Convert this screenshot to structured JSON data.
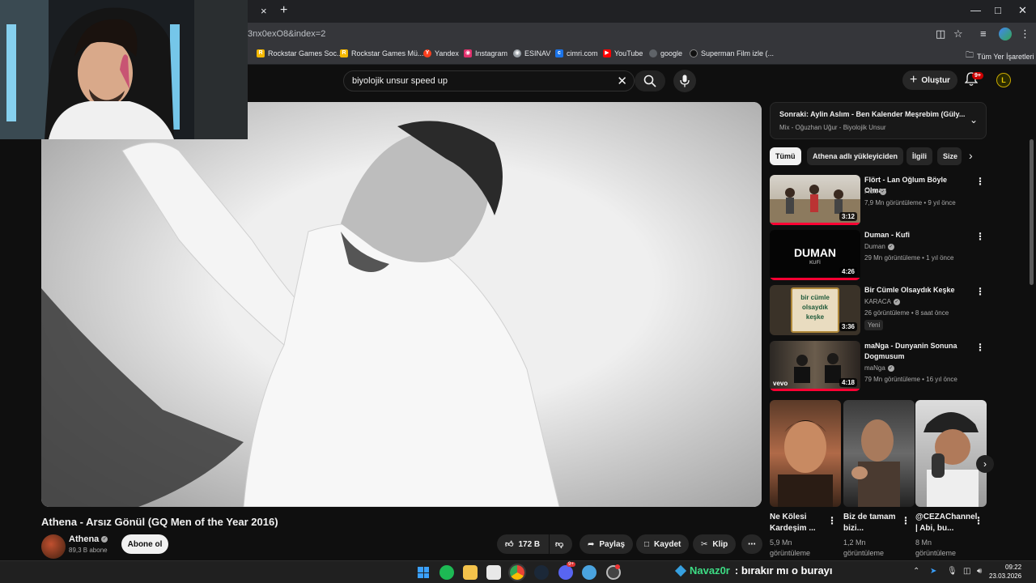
{
  "browser": {
    "url": "3nx0exO8&index=2",
    "tab_close": "×",
    "tab_new": "+",
    "bookmarks": [
      {
        "label": "Rockstar Games Soc...",
        "icon": "rockstar-icon",
        "color": "#f5b800"
      },
      {
        "label": "Rockstar Games Mü...",
        "icon": "rockstar-icon",
        "color": "#f5b800"
      },
      {
        "label": "Yandex",
        "icon": "yandex-icon",
        "color": "#fc3f1d"
      },
      {
        "label": "Instagram",
        "icon": "instagram-icon",
        "color": "#e1306c"
      },
      {
        "label": "ESINAV",
        "icon": "globe-icon",
        "color": "#9aa0a6"
      },
      {
        "label": "cimri.com",
        "icon": "cimri-icon",
        "color": "#1a73e8"
      },
      {
        "label": "YouTube",
        "icon": "youtube-icon",
        "color": "#ff0000"
      },
      {
        "label": "google",
        "icon": "globe-icon",
        "color": "#5f6368"
      },
      {
        "label": "Superman Film izle (...",
        "icon": "superman-icon",
        "color": "#202124"
      }
    ],
    "all_bookmarks": "Tüm Yer İşaretleri"
  },
  "youtube": {
    "search_value": "biyolojik unsur speed up",
    "create_label": "Oluştur",
    "notification_badge": "9+",
    "avatar_letter": "L",
    "video_title": "Athena - Arsız Gönül (GQ Men of the Year 2016)",
    "channel_name": "Athena",
    "subscribers": "89,3 B abone",
    "subscribe_label": "Abone ol",
    "likes": "172 B",
    "share_label": "Paylaş",
    "save_label": "Kaydet",
    "clip_label": "Klip",
    "next_up": {
      "title": "Sonraki: Aylin Aslım - Ben Kalender Meşrebim (Güly...",
      "subtitle": "Mix - Oğuzhan Uğur - Biyolojik Unsur"
    },
    "chips": [
      "Tümü",
      "Athena adlı yükleyiciden",
      "İlgili",
      "Size"
    ],
    "recommendations": [
      {
        "title": "Flört - Lan Oğlum Böyle Olmaz",
        "channel": "Flört",
        "meta": "7,9 Mn görüntüleme • 9 yıl önce",
        "duration": "3:12"
      },
      {
        "title": "Duman - Kufi",
        "channel": "Duman",
        "meta": "29 Mn görüntüleme • 1 yıl önce",
        "duration": "4:26",
        "thumb_text": "DUMAN",
        "thumb_sub": "KUFİ"
      },
      {
        "title": "Bir Cümle Olsaydık Keşke",
        "channel": "KARACA",
        "meta": "26 görüntüleme • 8 saat önce",
        "duration": "3:36",
        "badge": "Yeni",
        "thumb_text": "bir cümle olsaydık keşke"
      },
      {
        "title": "maNga - Dunyanin Sonuna Dogmusum",
        "channel": "maNga",
        "meta": "79 Mn görüntüleme • 16 yıl önce",
        "duration": "4:18",
        "thumb_tag": "vevo"
      }
    ],
    "shorts": [
      {
        "title": "Ne Kölesi Kardeşim ...",
        "views": "5,9 Mn görüntüleme"
      },
      {
        "title": "Biz de tamam bizi...",
        "views": "1,2 Mn görüntüleme"
      },
      {
        "title": "@CEZAChannel | Abi, bu...",
        "views": "8 Mn görüntüleme"
      }
    ]
  },
  "taskbar": {
    "stream_user": "Navaz0r",
    "stream_message": ": bırakır mı o burayı",
    "time": "09:22",
    "date": "23.03.2026",
    "chrome_badge": "9+"
  }
}
